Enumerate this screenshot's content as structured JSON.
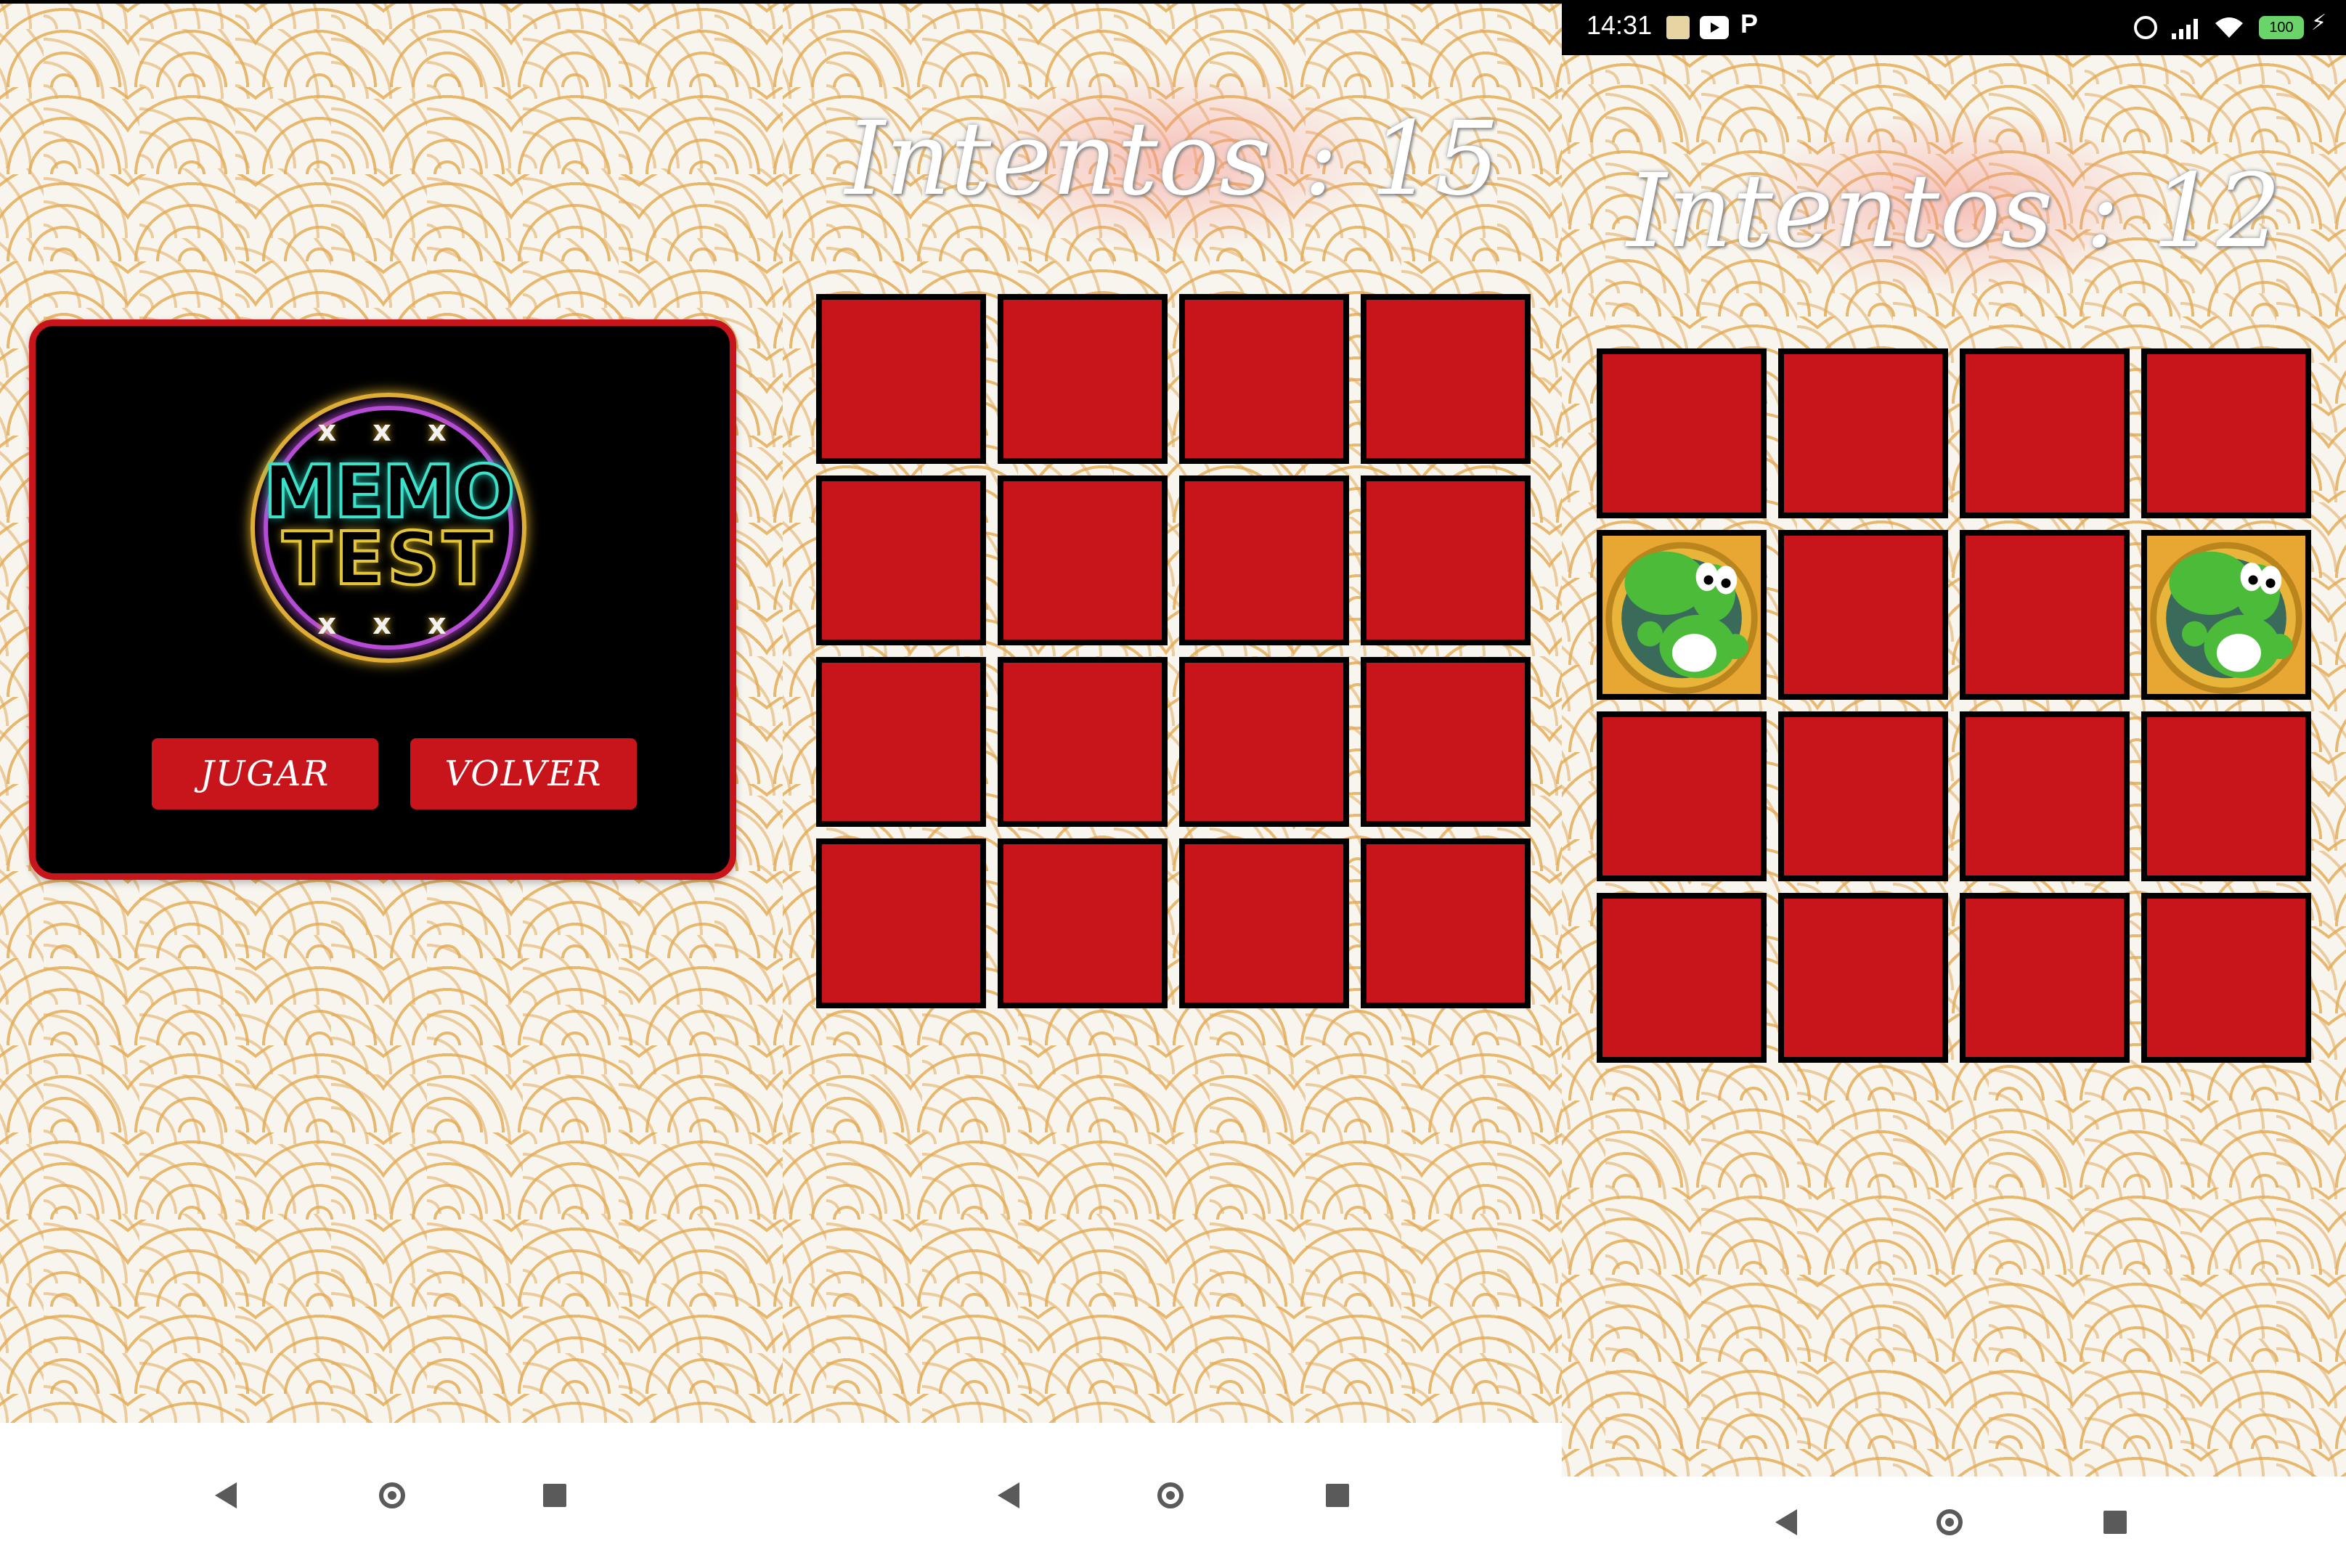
{
  "screen_menu": {
    "logo_text": [
      "MEMO",
      "TEST"
    ],
    "logo_decoration": "x x x",
    "buttons": {
      "play": "JUGAR",
      "back": "VOLVER"
    }
  },
  "screen_game_1": {
    "attempts_label": "Intentos : 15",
    "cards": [
      "hidden",
      "hidden",
      "hidden",
      "hidden",
      "hidden",
      "hidden",
      "hidden",
      "hidden",
      "hidden",
      "hidden",
      "hidden",
      "hidden",
      "hidden",
      "hidden",
      "hidden",
      "hidden"
    ]
  },
  "screen_game_2": {
    "status_bar": {
      "time": "14:31",
      "battery": "100"
    },
    "attempts_label": "Intentos : 12",
    "cards": [
      "hidden",
      "hidden",
      "hidden",
      "hidden",
      "yoshi",
      "hidden",
      "hidden",
      "yoshi",
      "hidden",
      "hidden",
      "hidden",
      "hidden",
      "hidden",
      "hidden",
      "hidden",
      "hidden"
    ]
  },
  "navigation": {
    "icons": [
      "back-icon",
      "home-icon",
      "recents-icon"
    ]
  },
  "colors": {
    "card_back": "#c8141b",
    "card_border": "#000000",
    "menu_bg": "#000000",
    "accent": "#c8141b"
  }
}
